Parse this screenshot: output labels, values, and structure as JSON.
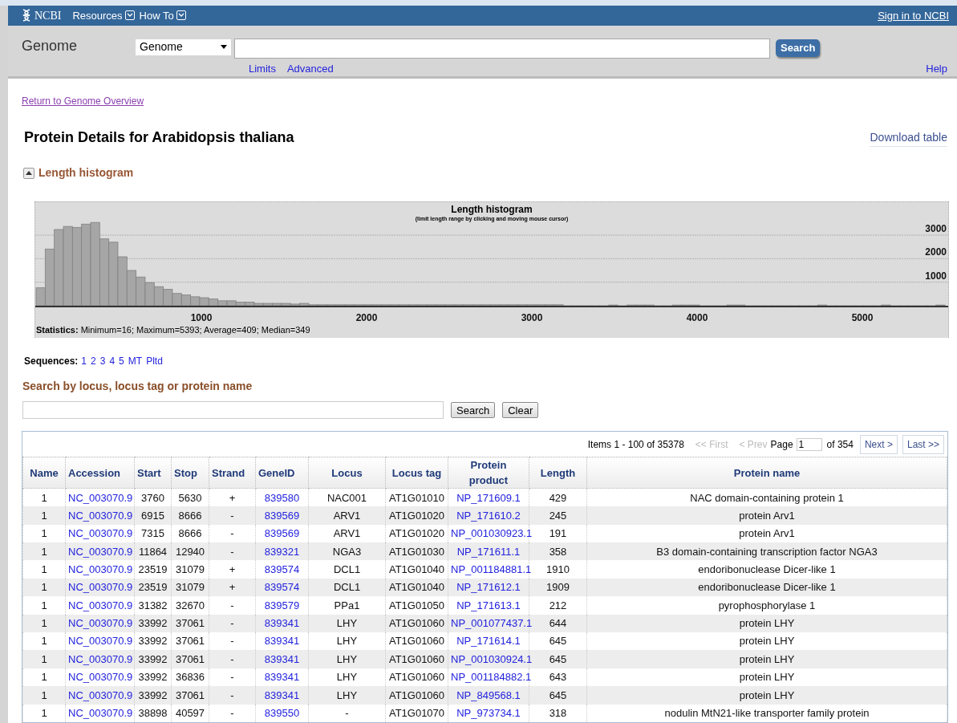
{
  "header": {
    "logo": "NCBI",
    "menus": [
      {
        "label": "Resources"
      },
      {
        "label": "How To"
      }
    ],
    "sign_in": "Sign in to NCBI"
  },
  "search_bar": {
    "title": "Genome",
    "database": "Genome",
    "button": "Search",
    "links": [
      "Limits",
      "Advanced"
    ],
    "help": "Help"
  },
  "back_link": "Return to Genome Overview",
  "page_title": "Protein Details for Arabidopsis thaliana",
  "download_link": "Download table",
  "histogram_section": {
    "toggle_label": "Length histogram",
    "expanded": true,
    "subtitle": "(limit length range by clicking and moving mouse cursor)",
    "statistics": "**Statistics:** Minimum=16; Maximum=5393; Average=409; Median=349",
    "chart_data": {
      "type": "bar",
      "title": "Length histogram",
      "grid": true,
      "xlim": [
        0,
        5500
      ],
      "ylim": [
        -1400,
        4400
      ],
      "xticks": [
        1000,
        2000,
        3000,
        4000,
        5000
      ],
      "yticks": [
        1000,
        2000,
        3000
      ],
      "x": [
        27.5,
        82.5,
        137.5,
        192.5,
        247.5,
        302.5,
        357.5,
        412.5,
        467.5,
        522.5,
        577.5,
        632.5,
        687.5,
        742.5,
        797.5,
        852.5,
        907.5,
        962.5,
        1017.5,
        1072.5,
        1127.5,
        1182.5,
        1237.5,
        1292.5,
        1347.5,
        1402.5,
        1457.5,
        1512.5,
        1567.5,
        1622.5,
        1677.5,
        1732.5,
        1787.5,
        1842.5,
        1897.5,
        1952.5,
        2007.5,
        2062.5,
        2117.5,
        2172.5,
        2227.5,
        2282.5,
        2337.5,
        2392.5,
        2447.5,
        2502.5,
        2557.5,
        2612.5,
        2667.5,
        2722.5,
        2777.5,
        2832.5,
        2887.5,
        2942.5,
        2997.5,
        3052.5,
        3107.5,
        3162.5,
        3217.5,
        3272.5,
        3327.5,
        3382.5,
        3437.5,
        3492.5,
        3547.5,
        3602.5,
        3657.5,
        3712.5,
        3767.5,
        3822.5,
        3877.5,
        3932.5,
        3987.5,
        4042.5,
        4097.5,
        4152.5,
        4207.5,
        4262.5,
        4317.5,
        4372.5,
        4427.5,
        4482.5,
        4537.5,
        4592.5,
        4647.5,
        4702.5,
        4757.5,
        4812.5,
        4867.5,
        4922.5,
        4977.5,
        5032.5,
        5087.5,
        5142.5,
        5197.5,
        5252.5,
        5307.5,
        5362.5,
        5417.5,
        5472.5
      ],
      "values": [
        760,
        2410,
        3240,
        3370,
        3330,
        3470,
        3540,
        2840,
        2700,
        2080,
        1500,
        1220,
        980,
        810,
        700,
        520,
        460,
        380,
        340,
        290,
        210,
        210,
        150,
        150,
        100,
        100,
        100,
        100,
        70,
        100,
        40,
        40,
        40,
        40,
        40,
        40,
        40,
        40,
        40,
        40,
        40,
        40,
        40,
        40,
        40,
        40,
        40,
        40,
        40,
        40,
        40,
        40,
        40,
        40,
        40,
        40,
        40,
        40,
        0,
        0,
        0,
        0,
        0,
        30,
        0,
        30,
        30,
        30,
        0,
        0,
        30,
        30,
        30,
        0,
        0,
        0,
        30,
        30,
        0,
        0,
        0,
        0,
        0,
        0,
        0,
        0,
        30,
        0,
        0,
        0,
        0,
        0,
        0,
        30,
        0,
        0,
        0,
        0,
        0,
        30
      ]
    }
  },
  "sequences": {
    "label": "Sequences:",
    "links": [
      "1",
      "2",
      "3",
      "4",
      "5",
      "MT",
      "Pltd"
    ]
  },
  "locus_search": {
    "heading": "Search by locus, locus tag or protein name",
    "buttons": [
      "Search",
      "Clear"
    ]
  },
  "table": {
    "pagination": {
      "items": "Items 1 - 100 of 35378",
      "first": {
        "label": "<< First",
        "disabled": true
      },
      "prev": {
        "label": "< Prev",
        "disabled": true
      },
      "page_label": "Page",
      "page_value": "1",
      "of": "of 354",
      "next": {
        "label": "Next >",
        "disabled": false
      },
      "last": {
        "label": "Last >>",
        "disabled": false
      }
    },
    "columns": [
      {
        "label": "Name",
        "link": false
      },
      {
        "label": "Accession",
        "link": true
      },
      {
        "label": "Start",
        "link": false
      },
      {
        "label": "Stop",
        "link": false
      },
      {
        "label": "Strand",
        "link": false
      },
      {
        "label": "GeneID",
        "link": true
      },
      {
        "label": "Locus",
        "link": false
      },
      {
        "label": "Locus tag",
        "link": false
      },
      {
        "label": "Protein product",
        "link": true
      },
      {
        "label": "Length",
        "link": false
      },
      {
        "label": "Protein name",
        "link": false
      }
    ],
    "rows": [
      [
        "1",
        "NC_003070.9",
        "3760",
        "5630",
        "+",
        "839580",
        "NAC001",
        "AT1G01010",
        "NP_171609.1",
        "429",
        "NAC domain-containing protein 1"
      ],
      [
        "1",
        "NC_003070.9",
        "6915",
        "8666",
        "-",
        "839569",
        "ARV1",
        "AT1G01020",
        "NP_171610.2",
        "245",
        "protein Arv1"
      ],
      [
        "1",
        "NC_003070.9",
        "7315",
        "8666",
        "-",
        "839569",
        "ARV1",
        "AT1G01020",
        "NP_001030923.1",
        "191",
        "protein Arv1"
      ],
      [
        "1",
        "NC_003070.9",
        "11864",
        "12940",
        "-",
        "839321",
        "NGA3",
        "AT1G01030",
        "NP_171611.1",
        "358",
        "B3 domain-containing transcription factor NGA3"
      ],
      [
        "1",
        "NC_003070.9",
        "23519",
        "31079",
        "+",
        "839574",
        "DCL1",
        "AT1G01040",
        "NP_001184881.1",
        "1910",
        "endoribonuclease Dicer-like 1"
      ],
      [
        "1",
        "NC_003070.9",
        "23519",
        "31079",
        "+",
        "839574",
        "DCL1",
        "AT1G01040",
        "NP_171612.1",
        "1909",
        "endoribonuclease Dicer-like 1"
      ],
      [
        "1",
        "NC_003070.9",
        "31382",
        "32670",
        "-",
        "839579",
        "PPa1",
        "AT1G01050",
        "NP_171613.1",
        "212",
        "pyrophosphorylase 1"
      ],
      [
        "1",
        "NC_003070.9",
        "33992",
        "37061",
        "-",
        "839341",
        "LHY",
        "AT1G01060",
        "NP_001077437.1",
        "644",
        "protein LHY"
      ],
      [
        "1",
        "NC_003070.9",
        "33992",
        "37061",
        "-",
        "839341",
        "LHY",
        "AT1G01060",
        "NP_171614.1",
        "645",
        "protein LHY"
      ],
      [
        "1",
        "NC_003070.9",
        "33992",
        "37061",
        "-",
        "839341",
        "LHY",
        "AT1G01060",
        "NP_001030924.1",
        "645",
        "protein LHY"
      ],
      [
        "1",
        "NC_003070.9",
        "33992",
        "36836",
        "-",
        "839341",
        "LHY",
        "AT1G01060",
        "NP_001184882.1",
        "643",
        "protein LHY"
      ],
      [
        "1",
        "NC_003070.9",
        "33992",
        "37061",
        "-",
        "839341",
        "LHY",
        "AT1G01060",
        "NP_849568.1",
        "645",
        "protein LHY"
      ],
      [
        "1",
        "NC_003070.9",
        "38898",
        "40597",
        "-",
        "839550",
        "-",
        "AT1G01070",
        "NP_973734.1",
        "318",
        "nodulin MtN21-like transporter family protein"
      ]
    ]
  }
}
